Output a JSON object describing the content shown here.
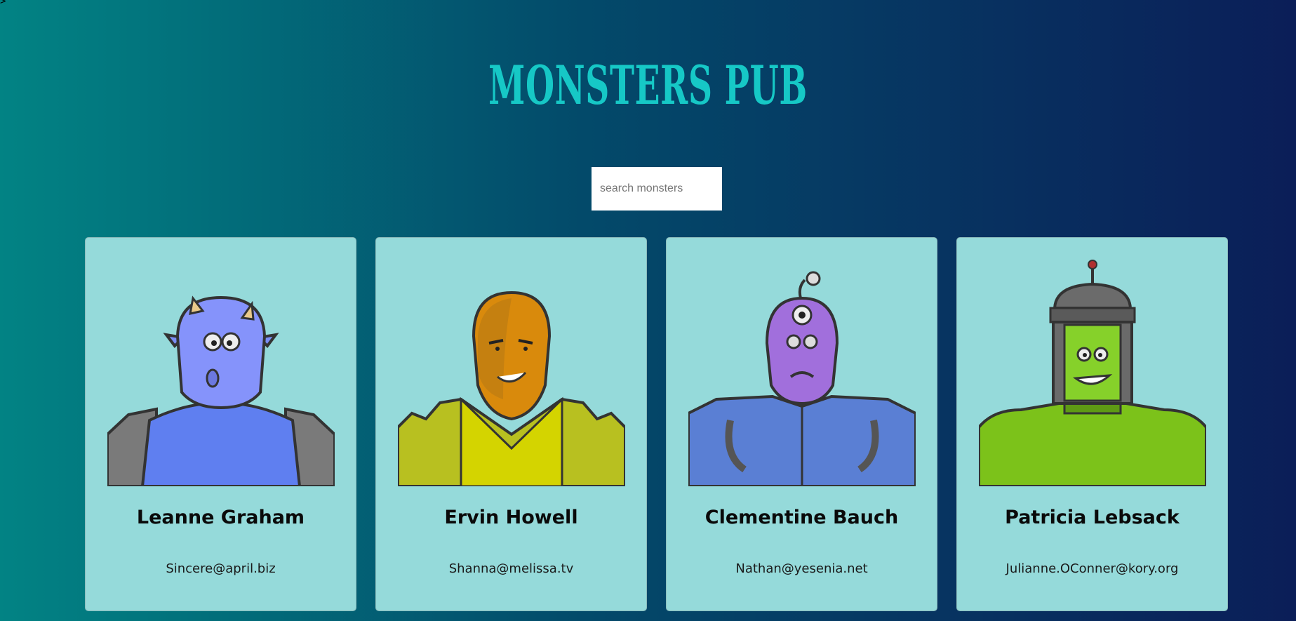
{
  "stray_text": ">",
  "app": {
    "title": "MONSTERS PUB"
  },
  "search": {
    "placeholder": "search monsters",
    "value": ""
  },
  "monsters": [
    {
      "name": "Leanne Graham",
      "email": "Sincere@april.biz",
      "avatar_icon": "blue-horned-monster-icon"
    },
    {
      "name": "Ervin Howell",
      "email": "Shanna@melissa.tv",
      "avatar_icon": "orange-hooded-monster-icon"
    },
    {
      "name": "Clementine Bauch",
      "email": "Nathan@yesenia.net",
      "avatar_icon": "purple-cyclops-monster-icon"
    },
    {
      "name": "Patricia Lebsack",
      "email": "Julianne.OConner@kory.org",
      "avatar_icon": "green-robot-monster-icon"
    }
  ],
  "colors": {
    "background_start": "#028384",
    "background_end": "#0b1e58",
    "title": "#16c8c6",
    "card": "#95dada"
  }
}
